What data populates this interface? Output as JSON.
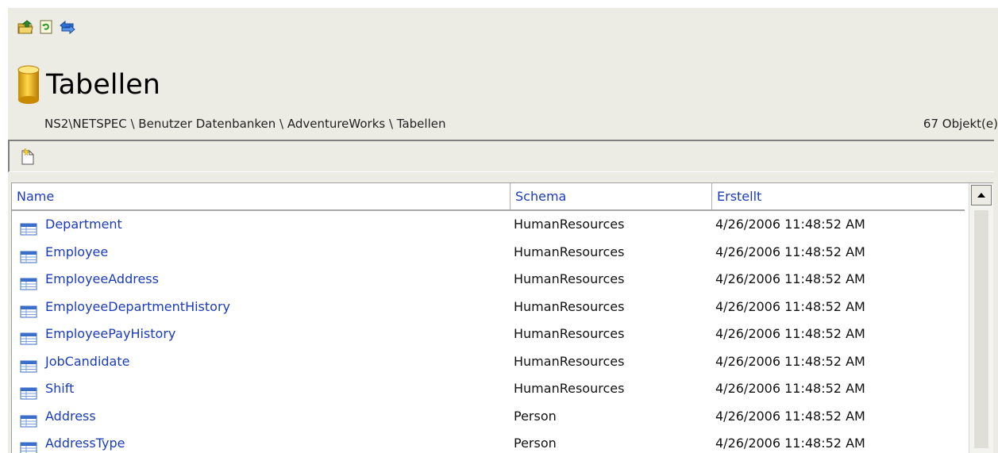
{
  "toolbar": {
    "icons": [
      "folder-up-icon",
      "refresh-icon",
      "sync-icon"
    ]
  },
  "header": {
    "title": "Tabellen",
    "breadcrumb": "NS2\\NETSPEC \\ Benutzer Datenbanken \\ AdventureWorks \\ Tabellen",
    "count": "67 Objekt(e)"
  },
  "action_bar": {
    "icon": "new-item-icon"
  },
  "table": {
    "columns": [
      "Name",
      "Schema",
      "Erstellt"
    ],
    "rows": [
      {
        "name": "Department",
        "schema": "HumanResources",
        "created": "4/26/2006 11:48:52 AM"
      },
      {
        "name": "Employee",
        "schema": "HumanResources",
        "created": "4/26/2006 11:48:52 AM"
      },
      {
        "name": "EmployeeAddress",
        "schema": "HumanResources",
        "created": "4/26/2006 11:48:52 AM"
      },
      {
        "name": "EmployeeDepartmentHistory",
        "schema": "HumanResources",
        "created": "4/26/2006 11:48:52 AM"
      },
      {
        "name": "EmployeePayHistory",
        "schema": "HumanResources",
        "created": "4/26/2006 11:48:52 AM"
      },
      {
        "name": "JobCandidate",
        "schema": "HumanResources",
        "created": "4/26/2006 11:48:52 AM"
      },
      {
        "name": "Shift",
        "schema": "HumanResources",
        "created": "4/26/2006 11:48:52 AM"
      },
      {
        "name": "Address",
        "schema": "Person",
        "created": "4/26/2006 11:48:52 AM"
      },
      {
        "name": "AddressType",
        "schema": "Person",
        "created": "4/26/2006 11:48:52 AM"
      }
    ]
  },
  "colors": {
    "link": "#1a3cb8",
    "background": "#ecebe4"
  }
}
